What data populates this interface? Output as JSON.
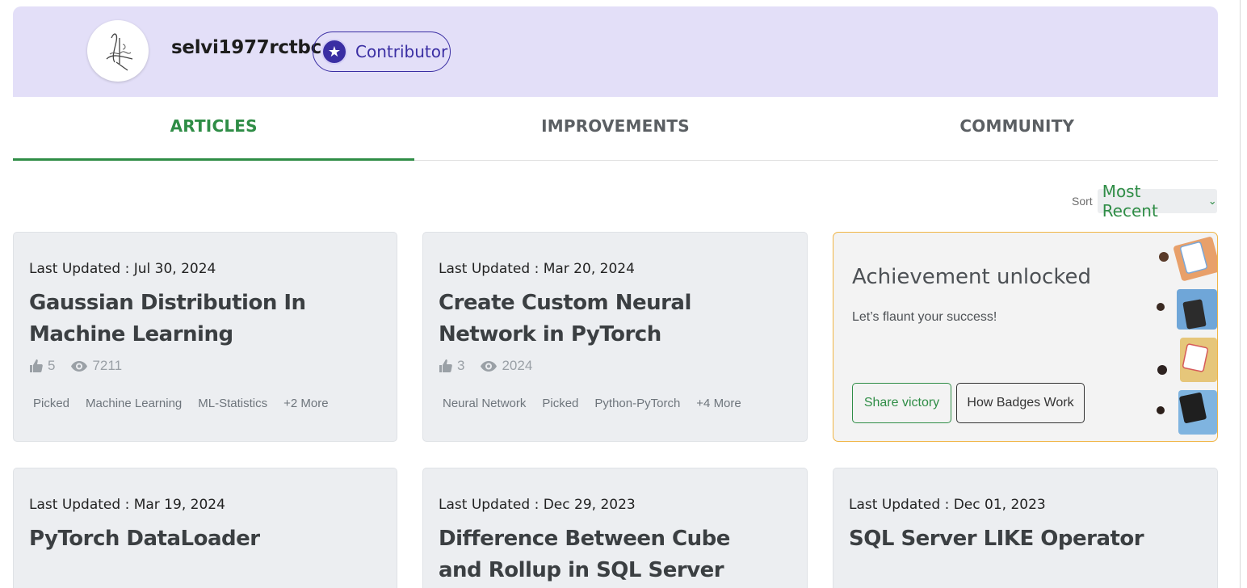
{
  "profile": {
    "username": "selvi1977rctbc",
    "role": "Contributor",
    "avatar_icon": "signature-avatar-icon",
    "role_icon": "star-icon",
    "header_bg": "#e3dff8",
    "role_color": "#3a2ea3"
  },
  "tabs": [
    {
      "label": "ARTICLES",
      "active": true
    },
    {
      "label": "IMPROVEMENTS",
      "active": false
    },
    {
      "label": "COMMUNITY",
      "active": false
    }
  ],
  "accent_color": "#2f8d46",
  "sort": {
    "label": "Sort",
    "value": "Most Recent"
  },
  "articles": [
    {
      "updated": "Last Updated : Jul 30, 2024",
      "title": "Gaussian Distribution In Machine Learning",
      "likes": "5",
      "views": "7211",
      "tags": [
        "Picked",
        "Machine Learning",
        "ML-Statistics",
        "+2 More"
      ]
    },
    {
      "updated": "Last Updated : Mar 20, 2024",
      "title": "Create Custom Neural Network in PyTorch",
      "likes": "3",
      "views": "2024",
      "tags": [
        "Neural Network",
        "Picked",
        "Python-PyTorch",
        "+4 More"
      ]
    },
    {
      "updated": "Last Updated : Mar 19, 2024",
      "title": "PyTorch DataLoader"
    },
    {
      "updated": "Last Updated : Dec 29, 2023",
      "title": "Difference Between Cube and Rollup in SQL Server"
    },
    {
      "updated": "Last Updated : Dec 01, 2023",
      "title": "SQL Server LIKE Operator"
    }
  ],
  "achievement": {
    "title": "Achievement unlocked",
    "subtitle": "Let’s flaunt your success!",
    "share_label": "Share victory",
    "badges_label": "How Badges Work",
    "border_color": "#f0b545"
  }
}
